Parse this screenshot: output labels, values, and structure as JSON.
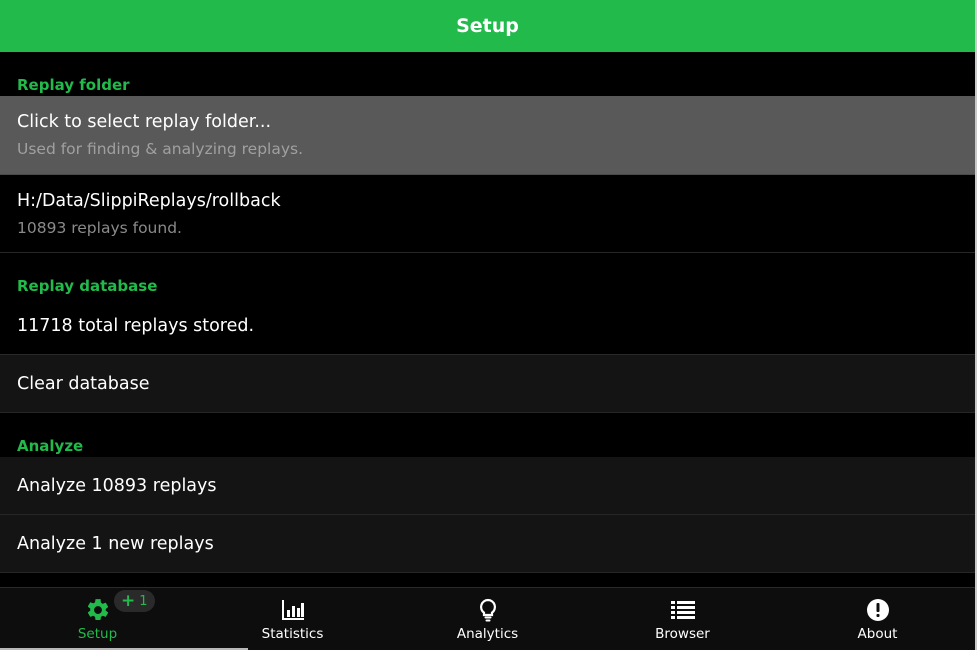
{
  "header": {
    "title": "Setup"
  },
  "replay_folder": {
    "section_title": "Replay folder",
    "select": {
      "title": "Click to select replay folder...",
      "subtitle": "Used for finding & analyzing replays."
    },
    "current": {
      "path": "H:/Data/SlippiReplays/rollback",
      "found": "10893 replays found."
    }
  },
  "replay_database": {
    "section_title": "Replay database",
    "stored": "11718 total replays stored.",
    "clear": "Clear database"
  },
  "analyze": {
    "section_title": "Analyze",
    "all": "Analyze 10893 replays",
    "new": "Analyze 1 new replays"
  },
  "nav": {
    "items": [
      {
        "label": "Setup",
        "icon": "gear-icon",
        "active": true
      },
      {
        "label": "Statistics",
        "icon": "bar-chart-icon"
      },
      {
        "label": "Analytics",
        "icon": "lightbulb-icon"
      },
      {
        "label": "Browser",
        "icon": "list-icon"
      },
      {
        "label": "About",
        "icon": "info-alert-icon"
      }
    ],
    "badge": {
      "plus": "+",
      "count": "1"
    }
  },
  "colors": {
    "accent": "#22ba4b",
    "background": "#000000",
    "selected_row": "#595959",
    "row_dark": "#141414"
  }
}
